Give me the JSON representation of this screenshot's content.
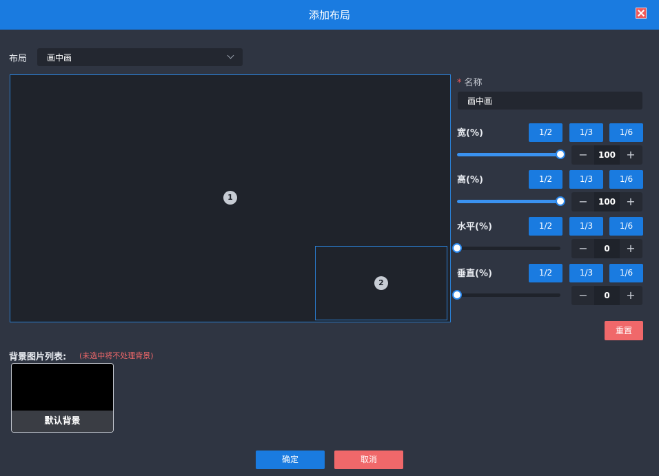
{
  "dialog": {
    "title": "添加布局",
    "close_icon": "close-icon"
  },
  "layout": {
    "label": "布局",
    "selected": "画中画"
  },
  "preview": {
    "windows": [
      "1",
      "2"
    ]
  },
  "name": {
    "required_mark": "*",
    "label": "名称",
    "value": "画中画"
  },
  "controls": [
    {
      "label": "宽(%)",
      "buttons": [
        "1/2",
        "1/3",
        "1/6"
      ],
      "value": "100",
      "level_percent": 100,
      "minus": "−",
      "plus": "+"
    },
    {
      "label": "高(%)",
      "buttons": [
        "1/2",
        "1/3",
        "1/6"
      ],
      "value": "100",
      "level_percent": 100,
      "minus": "−",
      "plus": "+"
    },
    {
      "label": "水平(%)",
      "buttons": [
        "1/2",
        "1/3",
        "1/6"
      ],
      "value": "0",
      "level_percent": 0,
      "minus": "−",
      "plus": "+"
    },
    {
      "label": "垂直(%)",
      "buttons": [
        "1/2",
        "1/3",
        "1/6"
      ],
      "value": "0",
      "level_percent": 0,
      "minus": "−",
      "plus": "+"
    }
  ],
  "reset_label": "重置",
  "background": {
    "label": "背景图片列表:",
    "hint": "(未选中将不处理背景)",
    "items": [
      {
        "caption": "默认背景"
      }
    ]
  },
  "footer": {
    "ok_label": "确定",
    "cancel_label": "取消"
  },
  "colors": {
    "accent": "#1a7be0",
    "danger": "#f0686a",
    "panel": "#2f3542"
  }
}
